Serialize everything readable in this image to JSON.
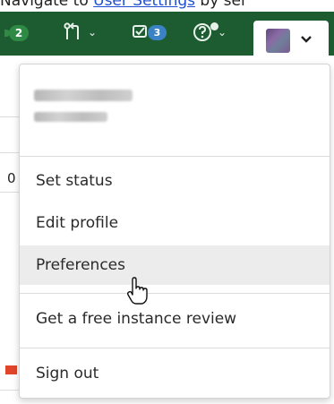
{
  "instruction": {
    "prefix": "Navigate to ",
    "link_text": "User Settings",
    "suffix": " by sel"
  },
  "navbar": {
    "bg_color": "#1d5c31",
    "issues_count": "2",
    "todos_count": "3",
    "mr_icon": "merge-request-icon",
    "todo_icon": "todo-check-icon",
    "help_icon": "help-question-icon"
  },
  "background_fragments": {
    "digit": "0"
  },
  "user_menu": {
    "name_blurred": "Lee, Charles",
    "username_blurred": "@lee-ch",
    "items": [
      {
        "label": "Set status"
      },
      {
        "label": "Edit profile"
      },
      {
        "label": "Preferences"
      },
      {
        "label": "Get a free instance review"
      },
      {
        "label": "Sign out"
      }
    ],
    "hovered_item": "Preferences"
  }
}
